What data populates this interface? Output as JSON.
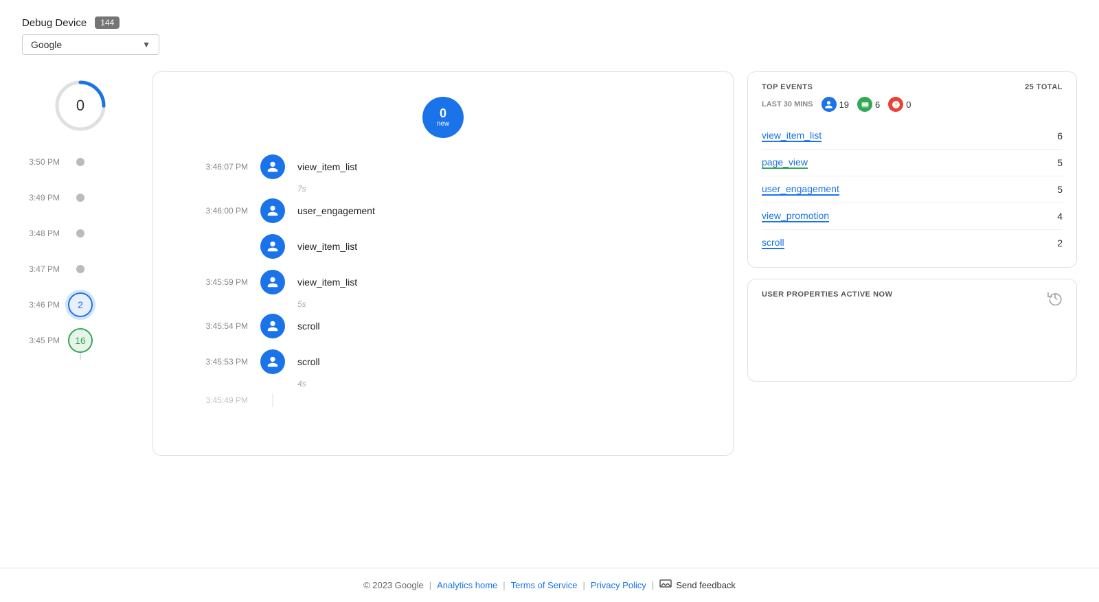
{
  "header": {
    "debug_label": "Debug Device",
    "debug_count": "144",
    "dropdown_value": "Google"
  },
  "left_timeline": {
    "top_number": "0",
    "items": [
      {
        "time": "3:50 PM",
        "type": "dot",
        "value": null,
        "highlighted": false
      },
      {
        "time": "3:49 PM",
        "type": "dot",
        "value": null,
        "highlighted": false
      },
      {
        "time": "3:48 PM",
        "type": "dot",
        "value": null,
        "highlighted": false
      },
      {
        "time": "3:47 PM",
        "type": "dot",
        "value": null,
        "highlighted": false
      },
      {
        "time": "3:46 PM",
        "type": "numbered",
        "value": "2",
        "style": "blue",
        "highlighted": true
      },
      {
        "time": "3:45 PM",
        "type": "numbered",
        "value": "16",
        "style": "green",
        "highlighted": false
      }
    ]
  },
  "events_panel": {
    "new_number": "0",
    "new_label": "new",
    "events": [
      {
        "time": "3:46:07 PM",
        "name": "view_item_list",
        "gap_after": "7s"
      },
      {
        "time": "3:46:00 PM",
        "name": "user_engagement",
        "gap_after": null
      },
      {
        "time": "",
        "name": "view_item_list",
        "gap_after": null
      },
      {
        "time": "3:45:59 PM",
        "name": "view_item_list",
        "gap_after": "5s"
      },
      {
        "time": "3:45:54 PM",
        "name": "scroll",
        "gap_after": null
      },
      {
        "time": "3:45:53 PM",
        "name": "scroll",
        "gap_after": "4s"
      },
      {
        "time": "3:45:49 PM",
        "name": "",
        "gap_after": null
      }
    ]
  },
  "top_events": {
    "title": "TOP EVENTS",
    "total_label": "25 TOTAL",
    "last30_label": "LAST 30 MINS",
    "blue_count": "19",
    "green_count": "6",
    "orange_count": "0",
    "rows": [
      {
        "name": "view_item_list",
        "count": "6",
        "underline": "blue"
      },
      {
        "name": "page_view",
        "count": "5",
        "underline": "green"
      },
      {
        "name": "user_engagement",
        "count": "5",
        "underline": "blue"
      },
      {
        "name": "view_promotion",
        "count": "4",
        "underline": "blue"
      },
      {
        "name": "scroll",
        "count": "2",
        "underline": "blue"
      }
    ]
  },
  "user_properties": {
    "title": "USER PROPERTIES ACTIVE NOW"
  },
  "footer": {
    "copyright": "© 2023 Google",
    "analytics_home": "Analytics home",
    "terms": "Terms of Service",
    "privacy": "Privacy Policy",
    "feedback": "Send feedback"
  }
}
